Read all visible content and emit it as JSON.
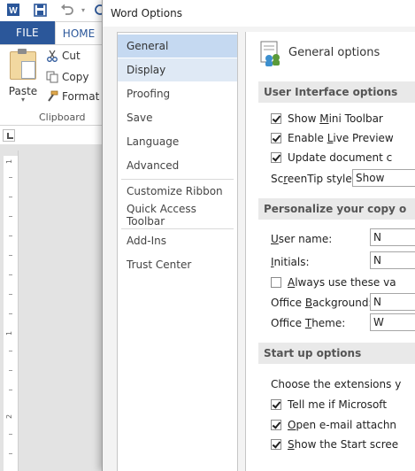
{
  "word": {
    "file_tab": "FILE",
    "home_tab": "HOME",
    "clipboard": {
      "paste": "Paste",
      "cut": "Cut",
      "copy": "Copy",
      "format_painter": "Format P",
      "group_label": "Clipboard"
    },
    "ruler_numbers": [
      "1",
      "1",
      "2"
    ]
  },
  "dialog": {
    "title": "Word Options",
    "nav": {
      "items": [
        "General",
        "Display",
        "Proofing",
        "Save",
        "Language",
        "Advanced",
        "Customize Ribbon",
        "Quick Access Toolbar",
        "Add-Ins",
        "Trust Center"
      ],
      "selected": "General"
    },
    "content": {
      "header": "General options",
      "ui_options": {
        "title": "User Interface options",
        "show_mini_toolbar": {
          "pre": "Show ",
          "u": "M",
          "post": "ini Toolbar",
          "checked": true
        },
        "enable_live_preview": {
          "pre": "Enable ",
          "u": "L",
          "post": "ive Preview",
          "checked": true
        },
        "update_document": {
          "pre": "Update document c",
          "u": "",
          "post": "",
          "checked": true
        },
        "screentip_label": {
          "pre": "Sc",
          "u": "r",
          "post": "eenTip style:"
        },
        "screentip_value": "Show"
      },
      "personalize": {
        "title": "Personalize your copy o",
        "user_name": {
          "pre": "",
          "u": "U",
          "post": "ser name:",
          "value": "N"
        },
        "initials": {
          "pre": "",
          "u": "I",
          "post": "nitials:",
          "value": "N"
        },
        "always_use": {
          "pre": "",
          "u": "A",
          "post": "lways use these va",
          "checked": false
        },
        "office_background": {
          "pre": "Office ",
          "u": "B",
          "post": "ackground:",
          "value": "N"
        },
        "office_theme": {
          "pre": "Office ",
          "u": "T",
          "post": "heme:",
          "value": "W"
        }
      },
      "startup": {
        "title": "Start up options",
        "choose_extensions": "Choose the extensions y",
        "tell_me": {
          "pre": "Tell me if Microsoft",
          "u": "",
          "post": "",
          "checked": true
        },
        "open_email": {
          "pre": "",
          "u": "O",
          "post": "pen e-mail attachn",
          "checked": true
        },
        "show_start_screen": {
          "pre": "",
          "u": "S",
          "post": "how the Start scree",
          "checked": true
        }
      }
    }
  }
}
